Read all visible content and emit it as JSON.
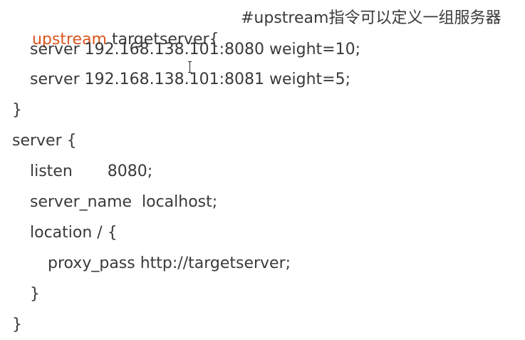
{
  "code": {
    "line1": {
      "keyword": "upstream",
      "rest": " targetserver{",
      "comment": "#upstream指令可以定义一组服务器"
    },
    "line2": "server 192.168.138.101:8080 weight=10;",
    "line3": "server 192.168.138.101:8081 weight=5;",
    "line4": "}",
    "line5": "server {",
    "line6": "listen       8080;",
    "line7": "server_name  localhost;",
    "line8": "location / {",
    "line9": "proxy_pass http://targetserver;",
    "line10": "}",
    "line11": "}"
  },
  "colors": {
    "keyword": "#d9541e",
    "text": "#3a3a3a",
    "background": "#ffffff"
  }
}
